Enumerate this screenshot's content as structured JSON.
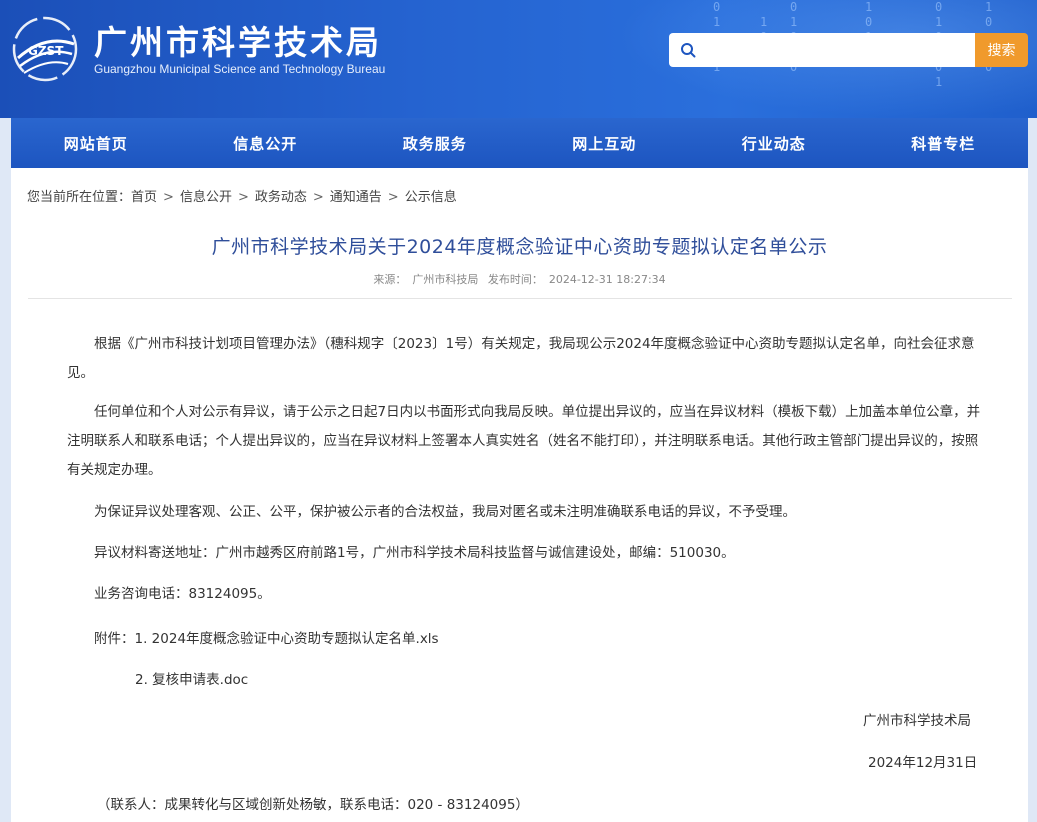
{
  "header": {
    "logo_text": "GZST",
    "title": "广州市科学技术局",
    "subtitle": "Guangzhou Municipal Science and Technology Bureau",
    "search": {
      "placeholder": "",
      "button_label": "搜索"
    }
  },
  "nav": {
    "items": [
      {
        "label": "网站首页"
      },
      {
        "label": "信息公开"
      },
      {
        "label": "政务服务"
      },
      {
        "label": "网上互动"
      },
      {
        "label": "行业动态"
      },
      {
        "label": "科普专栏"
      }
    ]
  },
  "breadcrumb": {
    "prefix": "您当前所在位置：",
    "items": [
      "首页",
      "信息公开",
      "政务动态",
      "通知通告",
      "公示信息"
    ],
    "separator": ">"
  },
  "article": {
    "title": "广州市科学技术局关于2024年度概念验证中心资助专题拟认定名单公示",
    "source_label": "来源：",
    "source": "广州市科技局",
    "time_label": "发布时间：",
    "time": "2024-12-31 18:27:34",
    "paragraphs": [
      "根据《广州市科技计划项目管理办法》（穗科规字〔2023〕1号）有关规定，我局现公示2024年度概念验证中心资助专题拟认定名单，向社会征求意见。",
      "任何单位和个人对公示有异议，请于公示之日起7日内以书面形式向我局反映。单位提出异议的，应当在异议材料（模板下载）上加盖本单位公章，并注明联系人和联系电话；个人提出异议的，应当在异议材料上签署本人真实姓名（姓名不能打印），并注明联系电话。其他行政主管部门提出异议的，按照有关规定办理。",
      "为保证异议处理客观、公正、公平，保护被公示者的合法权益，我局对匿名或未注明准确联系电话的异议，不予受理。",
      "异议材料寄送地址：广州市越秀区府前路1号，广州市科学技术局科技监督与诚信建设处，邮编：510030。",
      "业务咨询电话：83124095。"
    ],
    "attachments_label": "附件：",
    "attachments": [
      "1. 2024年度概念验证中心资助专题拟认定名单.xls",
      "2. 复核申请表.doc"
    ],
    "signature": "广州市科学技术局",
    "date": "2024年12月31日",
    "contact": "（联系人：成果转化与区域创新处杨敏，联系电话：020 - 83124095）"
  },
  "colors": {
    "banner": "#2563d0",
    "nav": "#2a66cf",
    "search_button": "#f09a2c",
    "title": "#2f4e9a"
  }
}
